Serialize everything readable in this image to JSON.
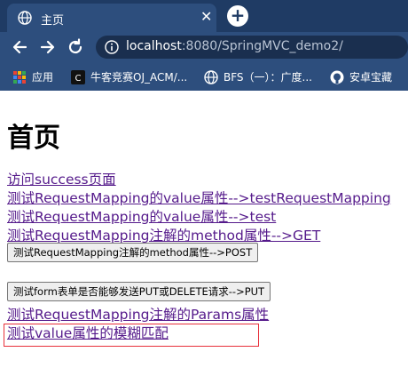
{
  "browser": {
    "tab_title": "主页",
    "tab_close": "✕",
    "new_tab": "+",
    "url_host": "localhost",
    "url_rest": ":8080/SpringMVC_demo2/",
    "bookmarks": [
      {
        "label": "应用",
        "icon": "apps-grid-icon"
      },
      {
        "label": "牛客竞赛OJ_ACM/...",
        "icon": "nowcoder-icon"
      },
      {
        "label": "BFS（一）：广度...",
        "icon": "globe-icon"
      },
      {
        "label": "安卓宝藏",
        "icon": "github-icon"
      }
    ]
  },
  "page": {
    "title": "首页",
    "links": [
      "访问success页面",
      "测试RequestMapping的value属性-->testRequestMapping",
      "测试RequestMapping的value属性-->test",
      "测试RequestMapping注解的method属性-->GET"
    ],
    "post_button": "测试RequestMapping注解的method属性-->POST",
    "put_button": "测试form表单是否能够发送PUT或DELETE请求-->PUT",
    "params_link": "测试RequestMapping注解的Params属性",
    "fuzzy_link": "测试value属性的模糊匹配"
  },
  "colors": {
    "chrome_dark": "#1f3b64",
    "chrome": "#2d4e7d",
    "visited_link": "#551a8b",
    "highlight": "#e8303a"
  }
}
